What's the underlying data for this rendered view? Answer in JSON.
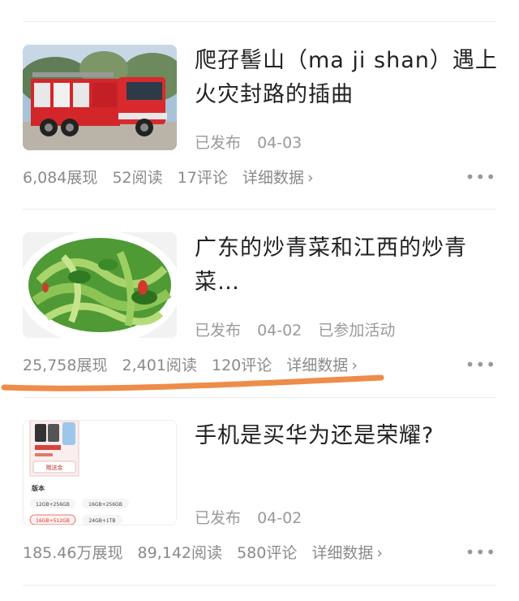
{
  "articles": [
    {
      "title": "爬孖髻山（ma ji shan）遇上火灾封路的插曲",
      "status": "已发布",
      "date": "04-03",
      "extra": "",
      "impressions": "6,084展现",
      "reads": "52阅读",
      "comments": "17评论",
      "detail_label": "详细数据",
      "more_label": "•••",
      "thumb_icon": "fire-truck-image"
    },
    {
      "title": "广东的炒青菜和江西的炒青菜…",
      "status": "已发布",
      "date": "04-02",
      "extra": "已参加活动",
      "impressions": "25,758展现",
      "reads": "2,401阅读",
      "comments": "120评论",
      "detail_label": "详细数据",
      "more_label": "•••",
      "thumb_icon": "stir-fried-greens-image"
    },
    {
      "title": "手机是买华为还是荣耀?",
      "status": "已发布",
      "date": "04-02",
      "extra": "",
      "impressions": "185.46万展现",
      "reads": "89,142阅读",
      "comments": "580评论",
      "detail_label": "详细数据",
      "more_label": "•••",
      "thumb_icon": "phone-product-screenshot",
      "thumb_text": {
        "promo": "赠送金",
        "section": "版本",
        "opt1": "12GB+256GB",
        "opt2": "16GB+256GB",
        "opt3": "16GB+512GB",
        "opt4": "24GB+1TB"
      }
    }
  ],
  "colors": {
    "annotation": "#ee8c4a",
    "text_primary": "#222222",
    "text_secondary": "#9a9a9a"
  }
}
